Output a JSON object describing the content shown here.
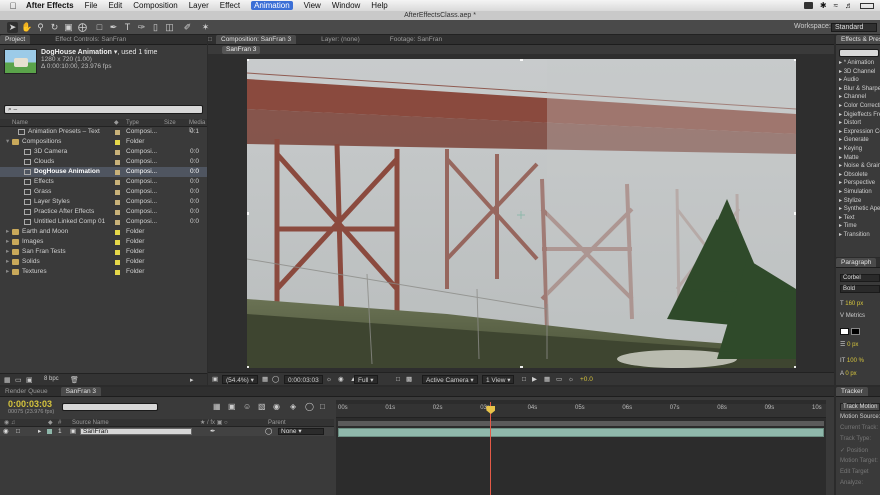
{
  "menubar": {
    "app": "After Effects",
    "items": [
      "File",
      "Edit",
      "Composition",
      "Layer",
      "Effect",
      "Animation",
      "View",
      "Window",
      "Help"
    ],
    "active_item": "Animation"
  },
  "title": "AfterEffectsClass.aep *",
  "workspace": {
    "label": "Workspace:",
    "value": "Standard"
  },
  "project": {
    "tabs": [
      "Project",
      "Effect Controls: SanFran"
    ],
    "selected_name": "DogHouse Animation",
    "used": ", used 1 time",
    "dimensions": "1280 x 720 (1.00)",
    "duration": "Δ 0:00:10:00, 23.976 fps",
    "search_placeholder": "⌕ –",
    "columns": {
      "name": "Name",
      "type": "Type",
      "size": "Size",
      "media": "Media D"
    },
    "items": [
      {
        "name": "Animation Presets – Text",
        "type": "Composi...",
        "media": "0:1",
        "indent": 1,
        "kind": "comp",
        "color": "#c9b27a"
      },
      {
        "name": "Compositions",
        "type": "Folder",
        "media": "",
        "indent": 0,
        "kind": "folder",
        "color": "#e6d84a"
      },
      {
        "name": "3D Camera",
        "type": "Composi...",
        "media": "0:0",
        "indent": 2,
        "kind": "comp",
        "color": "#c9b27a"
      },
      {
        "name": "Clouds",
        "type": "Composi...",
        "media": "0:0",
        "indent": 2,
        "kind": "comp",
        "color": "#c9b27a"
      },
      {
        "name": "DogHouse Animation",
        "type": "Composi...",
        "media": "0:0",
        "indent": 2,
        "kind": "comp",
        "color": "#c9b27a",
        "selected": true
      },
      {
        "name": "Effects",
        "type": "Composi...",
        "media": "0:0",
        "indent": 2,
        "kind": "comp",
        "color": "#c9b27a"
      },
      {
        "name": "Grass",
        "type": "Composi...",
        "media": "0:0",
        "indent": 2,
        "kind": "comp",
        "color": "#c9b27a"
      },
      {
        "name": "Layer Styles",
        "type": "Composi...",
        "media": "0:0",
        "indent": 2,
        "kind": "comp",
        "color": "#c9b27a"
      },
      {
        "name": "Practice After Effects",
        "type": "Composi...",
        "media": "0:0",
        "indent": 2,
        "kind": "comp",
        "color": "#c9b27a"
      },
      {
        "name": "Untitled Linked Comp 01",
        "type": "Composi...",
        "media": "0:0",
        "indent": 2,
        "kind": "comp",
        "color": "#c9b27a"
      },
      {
        "name": "Earth and Moon",
        "type": "Folder",
        "media": "",
        "indent": 0,
        "kind": "folder",
        "color": "#e6d84a"
      },
      {
        "name": "Images",
        "type": "Folder",
        "media": "",
        "indent": 0,
        "kind": "folder",
        "color": "#e6d84a"
      },
      {
        "name": "San Fran Tests",
        "type": "Folder",
        "media": "",
        "indent": 0,
        "kind": "folder",
        "color": "#e6d84a"
      },
      {
        "name": "Solids",
        "type": "Folder",
        "media": "",
        "indent": 0,
        "kind": "folder",
        "color": "#e6d84a"
      },
      {
        "name": "Textures",
        "type": "Folder",
        "media": "",
        "indent": 0,
        "kind": "folder",
        "color": "#e6d84a"
      }
    ],
    "bpc": "8 bpc"
  },
  "composition": {
    "tabs": [
      "Composition: SanFran 3",
      "Layer: (none)",
      "Footage: SanFran"
    ],
    "subtab": "SanFran 3",
    "footer": {
      "zoom": "(54.4%)",
      "time": "0:00:03:03",
      "resolution": "Full",
      "camera": "Active Camera",
      "view": "1 View",
      "exposure": "+0.0"
    }
  },
  "effects": {
    "tab": "Effects & Presets",
    "categories": [
      "* Animation",
      "3D Channel",
      "Audio",
      "Blur & Sharpen",
      "Channel",
      "Color Correction",
      "Digieffects FreeForm",
      "Distort",
      "Expression Controls",
      "Generate",
      "Keying",
      "Matte",
      "Noise & Grain",
      "Obsolete",
      "Perspective",
      "Simulation",
      "Stylize",
      "Synthetic Aperture",
      "Text",
      "Time",
      "Transition"
    ]
  },
  "paragraph": {
    "tab": "Paragraph",
    "font": "Corbel",
    "style": "Bold",
    "size": "160 px",
    "kerning": "Metrics",
    "stroke": "0 px",
    "vscale": "100 %",
    "baseline": "0 px"
  },
  "timeline": {
    "tabs": [
      "Render Queue",
      "SanFran 3"
    ],
    "time": "0:00:03:03",
    "fps": "00075 (23.976 fps)",
    "columns": {
      "source": "Source Name",
      "parent": "Parent"
    },
    "layer": {
      "index": "1",
      "name": "SanFran",
      "parent": "None"
    },
    "ruler": [
      "00s",
      "01s",
      "02s",
      "03s",
      "04s",
      "05s",
      "06s",
      "07s",
      "08s",
      "09s",
      "10s"
    ],
    "playhead_seconds": 3.13,
    "duration_seconds": 10
  },
  "tracker": {
    "tab": "Tracker",
    "items": [
      "Track Motion",
      "Motion Source:",
      "Current Track:",
      "Track Type:",
      "✓ Position",
      "Motion Target:",
      "Edit Target",
      "Analyze:"
    ]
  }
}
